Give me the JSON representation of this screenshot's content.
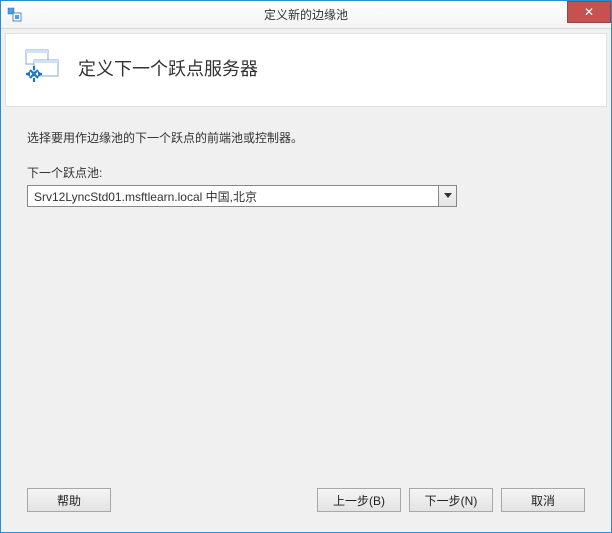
{
  "window": {
    "title": "定义新的边缘池",
    "close_symbol": "✕"
  },
  "header": {
    "heading": "定义下一个跃点服务器"
  },
  "body": {
    "instruction": "选择要用作边缘池的下一个跃点的前端池或控制器。",
    "field_label": "下一个跃点池:",
    "dropdown_selected": "Srv12LyncStd01.msftlearn.local   中国,北京"
  },
  "buttons": {
    "help": "帮助",
    "back": "上一步(B)",
    "next": "下一步(N)",
    "cancel": "取消"
  }
}
